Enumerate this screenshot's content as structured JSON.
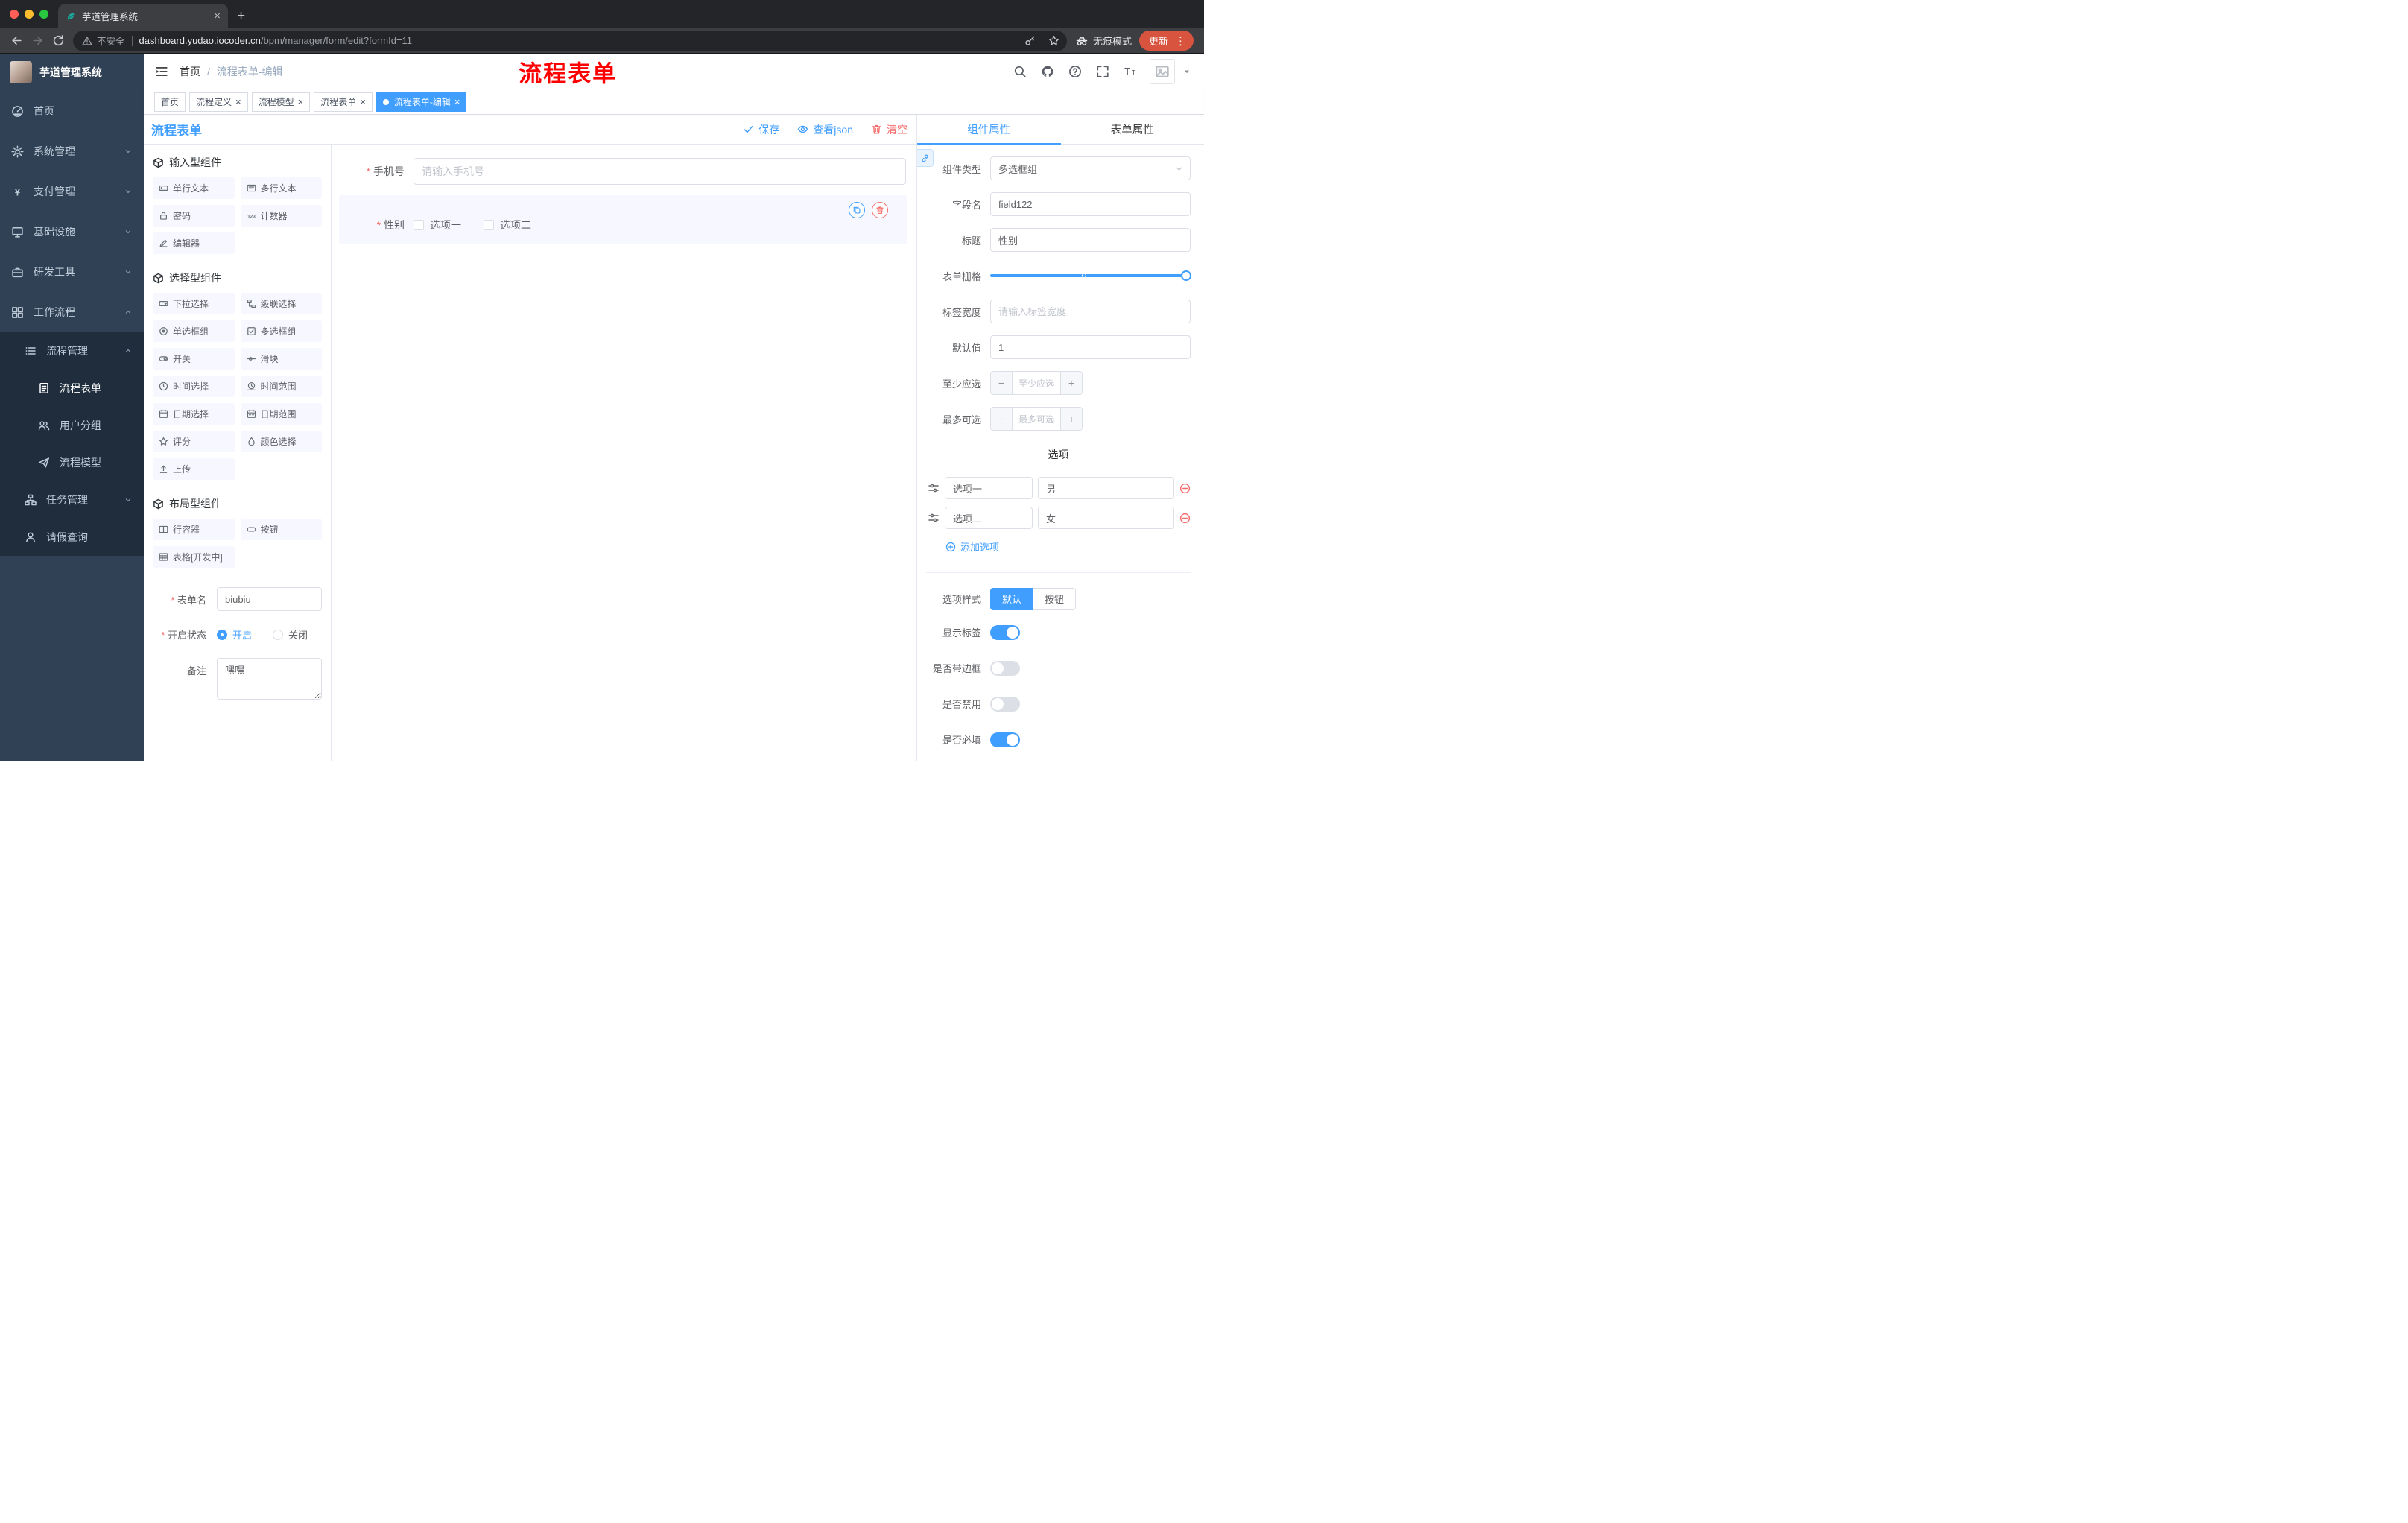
{
  "colors": {
    "primary": "#409eff",
    "danger": "#f56c6c",
    "watermark_red": "#ff0000",
    "sidebar_bg": "#304156"
  },
  "browser": {
    "tab_title": "芋道管理系统",
    "security_label": "不安全",
    "url_domain": "dashboard.yudao.iocoder.cn",
    "url_path": "/bpm/manager/form/edit?formId=11",
    "incognito_label": "无痕模式",
    "update_label": "更新"
  },
  "sidebar": {
    "logo_title": "芋道管理系统",
    "top_items": [
      {
        "label": "首页"
      },
      {
        "label": "系统管理"
      },
      {
        "label": "支付管理"
      },
      {
        "label": "基础设施"
      },
      {
        "label": "研发工具"
      },
      {
        "label": "工作流程"
      }
    ],
    "sub_items": [
      {
        "label": "流程管理"
      },
      {
        "label": "流程表单"
      },
      {
        "label": "用户分组"
      },
      {
        "label": "流程模型"
      },
      {
        "label": "任务管理"
      },
      {
        "label": "请假查询"
      }
    ]
  },
  "header": {
    "breadcrumb_home": "首页",
    "breadcrumb_sep": "/",
    "breadcrumb_current": "流程表单-编辑",
    "watermark": "流程表单"
  },
  "tags": [
    {
      "label": "首页"
    },
    {
      "label": "流程定义"
    },
    {
      "label": "流程模型"
    },
    {
      "label": "流程表单"
    },
    {
      "label": "流程表单-编辑"
    }
  ],
  "designer": {
    "title": "流程表单",
    "save": "保存",
    "view_json": "查看json",
    "clear": "清空"
  },
  "palette": {
    "group_input": "输入型组件",
    "group_select": "选择型组件",
    "group_layout": "布局型组件",
    "input_items": [
      "单行文本",
      "多行文本",
      "密码",
      "计数器",
      "编辑器"
    ],
    "select_items": [
      "下拉选择",
      "级联选择",
      "单选框组",
      "多选框组",
      "开关",
      "滑块",
      "时间选择",
      "时间范围",
      "日期选择",
      "日期范围",
      "评分",
      "颜色选择",
      "上传"
    ],
    "layout_items": [
      "行容器",
      "按钮",
      "表格[开发中]"
    ]
  },
  "meta": {
    "name_label": "表单名",
    "name_value": "biubiu",
    "status_label": "开启状态",
    "status_on": "开启",
    "status_off": "关闭",
    "remark_label": "备注",
    "remark_value": "嘿嘿"
  },
  "canvas": {
    "phone_label": "手机号",
    "phone_placeholder": "请输入手机号",
    "gender_label": "性别",
    "gender_opt1": "选项一",
    "gender_opt2": "选项二"
  },
  "props": {
    "tab_component": "组件属性",
    "tab_form": "表单属性",
    "type_label": "组件类型",
    "type_value": "多选框组",
    "field_label": "字段名",
    "field_value": "field122",
    "title_label": "标题",
    "title_value": "性别",
    "grid_label": "表单栅格",
    "width_label": "标签宽度",
    "width_placeholder": "请输入标签宽度",
    "default_label": "默认值",
    "default_value": "1",
    "min_label": "至少应选",
    "min_placeholder": "至少应选",
    "max_label": "最多可选",
    "max_placeholder": "最多可选",
    "minus": "−",
    "plus": "+",
    "options_title": "选项",
    "options": [
      {
        "label": "选项一",
        "value": "男"
      },
      {
        "label": "选项二",
        "value": "女"
      }
    ],
    "add_option": "添加选项",
    "style_label": "选项样式",
    "style_default": "默认",
    "style_button": "按钮",
    "show_label_label": "显示标签",
    "border_label": "是否带边框",
    "disabled_label": "是否禁用",
    "required_label": "是否必填"
  }
}
